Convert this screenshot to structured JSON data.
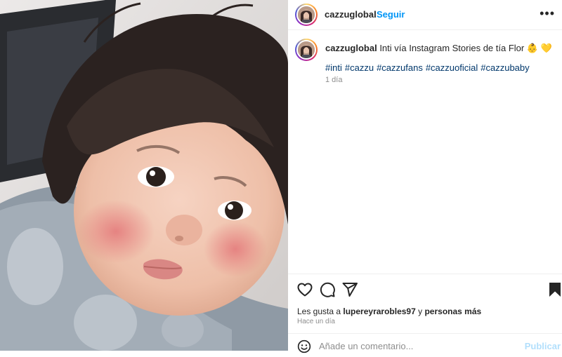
{
  "post": {
    "username": "cazzuglobal",
    "follow_label": "Seguir",
    "more_label": "•••",
    "caption": {
      "username": "cazzuglobal",
      "text": "Inti vía Instagram Stories de tía Flor 👶 💛",
      "hashtags": [
        "#inti",
        "#cazzu",
        "#cazzufans",
        "#cazzuoficial",
        "#cazzubaby"
      ],
      "time": "1 día"
    },
    "likes": {
      "prefix": "Les gusta a",
      "user": "lupereyrarobles97",
      "conjunction": "y",
      "others": "personas más"
    },
    "posted": "Hace un día",
    "comment": {
      "placeholder": "Añade un comentario...",
      "publish_label": "Publicar"
    }
  },
  "icons": {
    "like": "heart-icon",
    "comment": "comment-icon",
    "share": "send-icon",
    "save": "bookmark-icon",
    "emoji": "emoji-icon",
    "more": "more-icon"
  },
  "colors": {
    "link_blue": "#0095f6",
    "hashtag": "#00376b",
    "muted": "#8e8e8e",
    "publish_disabled": "#b2dffc"
  }
}
